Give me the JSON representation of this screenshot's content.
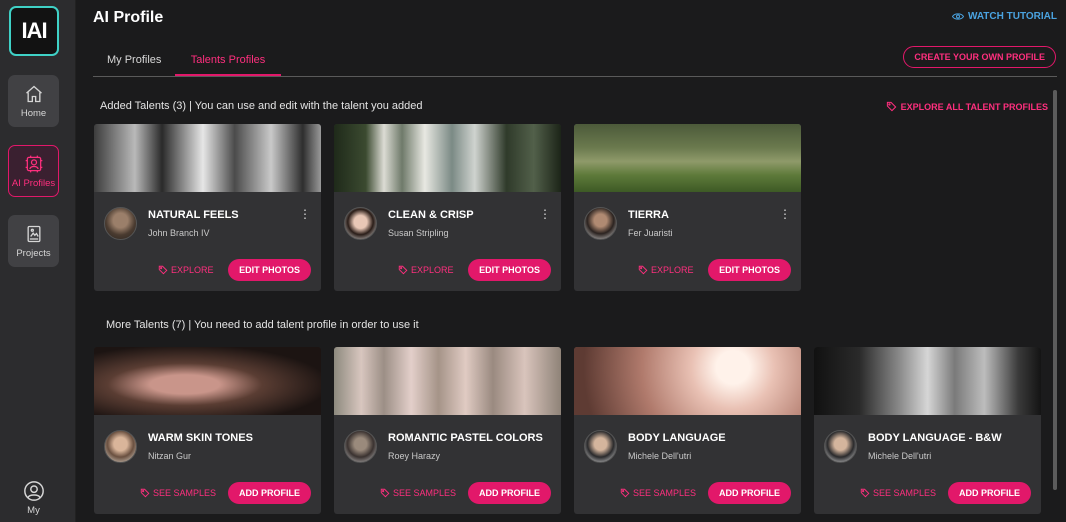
{
  "sidebar": {
    "logo_text": "IAI",
    "items": [
      {
        "label": "Home",
        "icon": "home-icon"
      },
      {
        "label": "AI Profiles",
        "icon": "ai-profile-icon"
      },
      {
        "label": "Projects",
        "icon": "projects-icon"
      }
    ],
    "my_label": "My"
  },
  "header": {
    "title": "AI Profile",
    "watch_tutorial": "WATCH TUTORIAL"
  },
  "tabs": [
    {
      "label": "My Profiles",
      "active": false
    },
    {
      "label": "Talents Profiles",
      "active": true
    }
  ],
  "create_button": "CREATE YOUR OWN PROFILE",
  "added_section": {
    "heading": "Added Talents (3) | You can use and edit with the talent you added",
    "explore_all": "EXPLORE ALL TALENT PROFILES",
    "cards": [
      {
        "title": "NATURAL FEELS",
        "author": "John Branch IV",
        "link": "EXPLORE",
        "action": "EDIT PHOTOS"
      },
      {
        "title": "CLEAN & CRISP",
        "author": "Susan Stripling",
        "link": "EXPLORE",
        "action": "EDIT PHOTOS"
      },
      {
        "title": "TIERRA",
        "author": "Fer Juaristi",
        "link": "EXPLORE",
        "action": "EDIT PHOTOS"
      }
    ]
  },
  "more_section": {
    "heading": "More Talents (7) | You need to add talent profile in order to use it",
    "cards": [
      {
        "title": "WARM SKIN TONES",
        "author": "Nitzan Gur",
        "link": "SEE SAMPLES",
        "action": "ADD PROFILE"
      },
      {
        "title": "ROMANTIC PASTEL COLORS",
        "author": "Roey Harazy",
        "link": "SEE SAMPLES",
        "action": "ADD PROFILE"
      },
      {
        "title": "BODY LANGUAGE",
        "author": "Michele Dell'utri",
        "link": "SEE SAMPLES",
        "action": "ADD PROFILE"
      },
      {
        "title": "BODY LANGUAGE - B&W",
        "author": "Michele Dell'utri",
        "link": "SEE SAMPLES",
        "action": "ADD PROFILE"
      }
    ]
  },
  "colors": {
    "accent": "#e2186a",
    "link_blue": "#4aa3e0",
    "logo_border": "#3fd1c6",
    "background": "#1b1b1c",
    "card": "#323234"
  }
}
